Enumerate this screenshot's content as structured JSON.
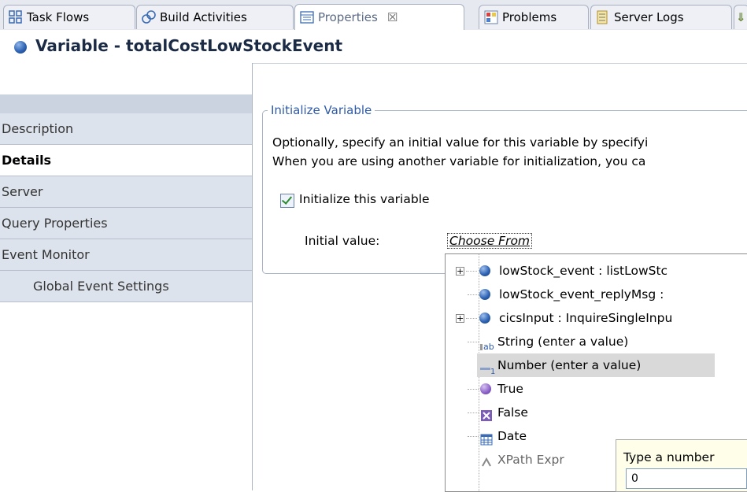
{
  "tabs": [
    {
      "label": "Task Flows",
      "icon": "task-flows-icon"
    },
    {
      "label": "Build Activities",
      "icon": "build-activities-icon"
    },
    {
      "label": "Properties",
      "icon": "properties-icon",
      "active": true,
      "close": "☒"
    },
    {
      "label": "Problems",
      "icon": "problems-icon"
    },
    {
      "label": "Server Logs",
      "icon": "server-logs-icon"
    }
  ],
  "header": {
    "title": "Variable - totalCostLowStockEvent"
  },
  "nav": {
    "items": [
      {
        "label": "Description"
      },
      {
        "label": "Details",
        "selected": true
      },
      {
        "label": "Server"
      },
      {
        "label": "Query Properties"
      },
      {
        "label": "Event Monitor"
      },
      {
        "label": "Global Event Settings"
      }
    ]
  },
  "section": {
    "legend": "Initialize Variable",
    "desc_line1": "Optionally, specify an initial value for this variable by specifyi",
    "desc_line2": "When you are using another variable for initialization, you ca",
    "checkbox_label": "Initialize this variable",
    "initial_value_label": "Initial value:",
    "choose_from": "Choose From"
  },
  "popup": {
    "items": [
      {
        "label": "lowStock_event : listLowStc",
        "icon": "variable-icon",
        "expandable": true
      },
      {
        "label": "lowStock_event_replyMsg :",
        "icon": "variable-icon",
        "expandable": false
      },
      {
        "label": "cicsInput : InquireSingleInpu",
        "icon": "variable-icon",
        "expandable": true
      },
      {
        "label": "String (enter a value)",
        "icon": "string-icon",
        "expandable": false
      },
      {
        "label": "Number (enter a value)",
        "icon": "number-icon",
        "expandable": false,
        "highlighted": true
      },
      {
        "label": "True",
        "icon": "true-icon",
        "expandable": false
      },
      {
        "label": "False",
        "icon": "false-icon",
        "expandable": false
      },
      {
        "label": "Date",
        "icon": "date-icon",
        "expandable": false
      },
      {
        "label": "XPath Expr",
        "icon": "xpath-icon",
        "expandable": false
      }
    ]
  },
  "number_entry": {
    "label": "Type a number",
    "value": "0"
  },
  "colors": {
    "accent": "#2e5aa8",
    "nav_bg": "#dde3ec",
    "tab_bar": "#e6e9f0"
  }
}
